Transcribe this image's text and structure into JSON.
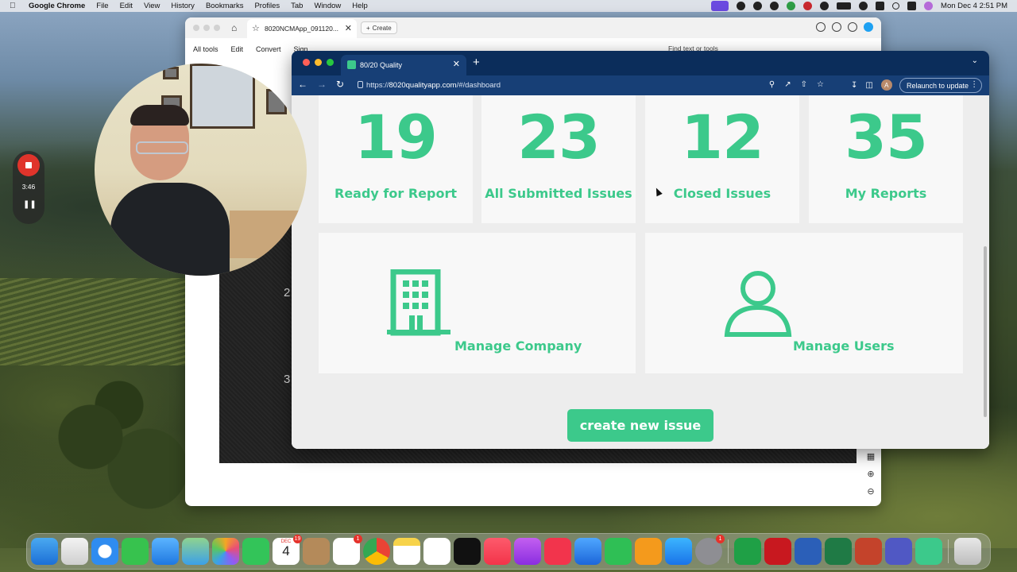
{
  "menubar": {
    "app_name": "Google Chrome",
    "menus": [
      "File",
      "Edit",
      "View",
      "History",
      "Bookmarks",
      "Profiles",
      "Tab",
      "Window",
      "Help"
    ],
    "clock": "Mon Dec 4  2:51 PM"
  },
  "recorder": {
    "elapsed": "3:46"
  },
  "acrobat": {
    "tab_title": "8020NCMApp_091120...",
    "create_label": "Create",
    "menu": [
      "All tools",
      "Edit",
      "Convert",
      "Sign"
    ],
    "find_placeholder": "Find text or tools",
    "page_numbers": [
      "2",
      "3"
    ]
  },
  "chrome": {
    "tab_title": "80/20 Quality",
    "url_scheme": "https://",
    "url_host": "8020qualityapp.com",
    "url_path": "/#/dashboard",
    "avatar_initial": "A",
    "relaunch_label": "Relaunch to update"
  },
  "dashboard": {
    "accent_color": "#3cc98b",
    "stats": [
      {
        "value": "19",
        "label": "Ready for Report"
      },
      {
        "value": "23",
        "label": "All Submitted Issues"
      },
      {
        "value": "12",
        "label": "Closed Issues"
      },
      {
        "value": "35",
        "label": "My Reports"
      }
    ],
    "manage_company_label": "Manage Company",
    "manage_users_label": "Manage Users",
    "create_button_label": "create new issue"
  },
  "dock": {
    "calendar_month": "DEC",
    "calendar_day": "4",
    "calendar_badge": "19",
    "reminders_badge": "1",
    "settings_badge": "1"
  }
}
